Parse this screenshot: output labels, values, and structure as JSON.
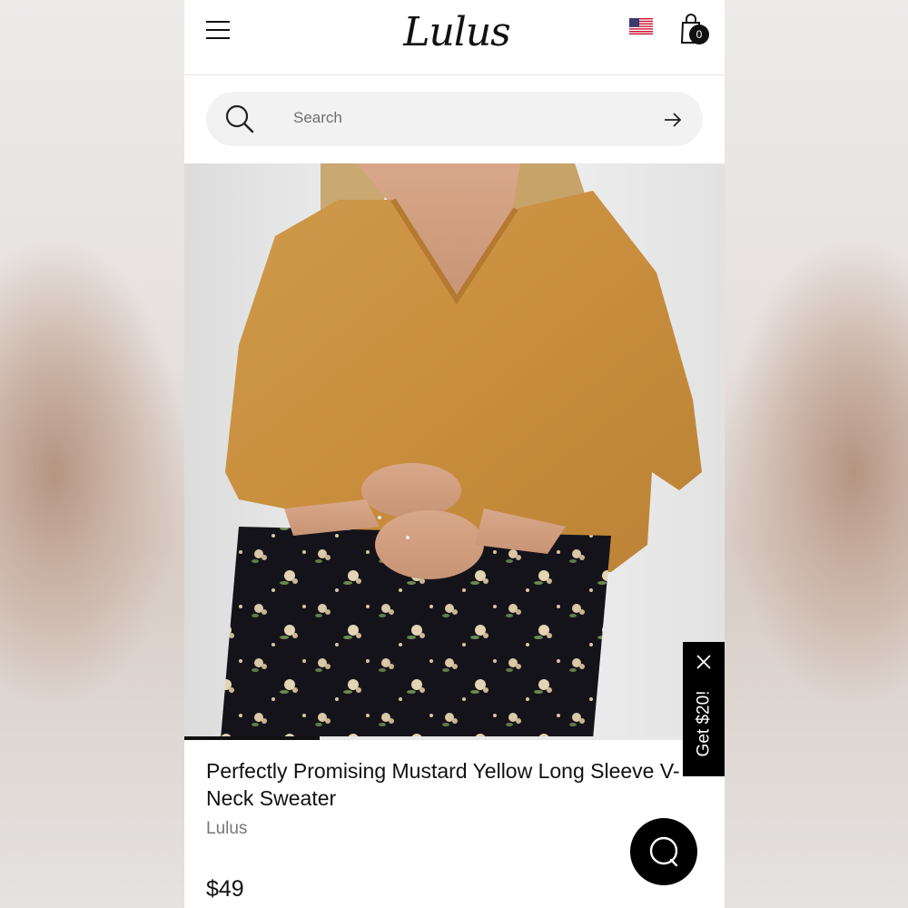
{
  "header": {
    "logo_text": "Lulus",
    "cart_count": "0",
    "flag": "us-flag-icon"
  },
  "search": {
    "placeholder": "Search"
  },
  "product": {
    "image_description_icon": "product-photo",
    "image_progress": 0.25,
    "title": "Perfectly Promising Mustard Yellow Long Sleeve V-Neck Sweater",
    "brand": "Lulus",
    "price": "$49"
  },
  "promo": {
    "label": "Get $20!"
  },
  "colors": {
    "accent": "#000000",
    "sweater": "#c8903f",
    "skirt": "#15131a"
  }
}
